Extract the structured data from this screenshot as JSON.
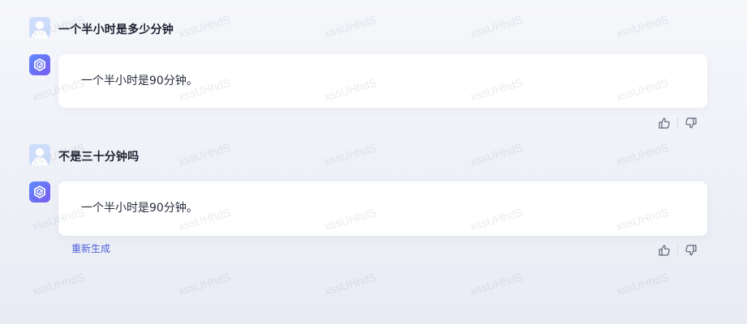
{
  "conversation": {
    "turns": [
      {
        "user_text": "一个半小时是多少分钟",
        "bot_text": "一个半小时是90分钟。"
      },
      {
        "user_text": "不是三十分钟吗",
        "bot_text": "一个半小时是90分钟。"
      }
    ],
    "regenerate_label": "重新生成"
  },
  "watermark": {
    "text": "xssUHhdS"
  },
  "icons": {
    "user_avatar": "user-avatar-icon",
    "bot_avatar": "bot-logo-icon",
    "like": "thumbs-up-icon",
    "dislike": "thumbs-down-icon"
  },
  "colors": {
    "background": "#eef0f7",
    "bubble": "#ffffff",
    "bot_avatar_gradient_start": "#5f8bff",
    "bot_avatar_gradient_end": "#7c5cf1",
    "user_avatar": "#cdddfb",
    "link": "#4d5fd6"
  }
}
